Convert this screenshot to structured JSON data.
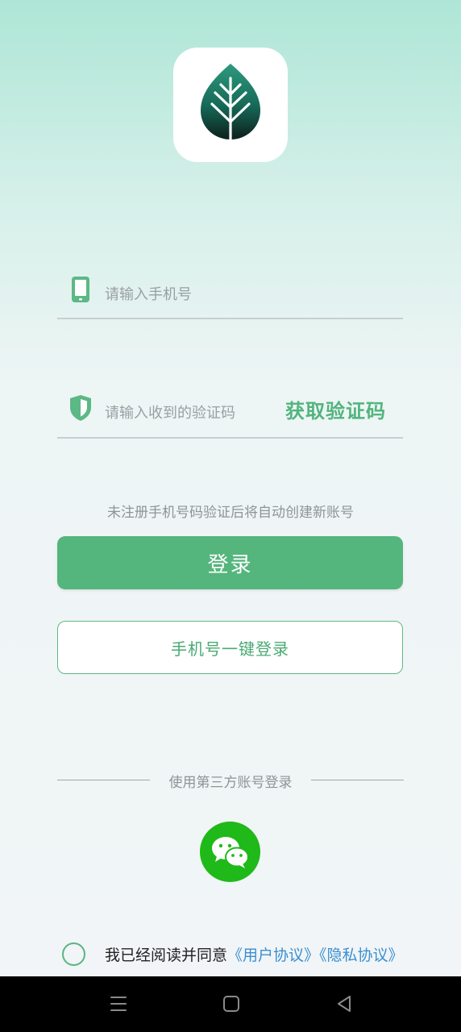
{
  "app": {
    "icon": "leaf-icon",
    "brand_color": "#54b67c"
  },
  "phone_field": {
    "icon": "phone-icon",
    "placeholder": "请输入手机号"
  },
  "code_field": {
    "icon": "shield-icon",
    "placeholder": "请输入收到的验证码",
    "get_code_label": "获取验证码"
  },
  "notice": "未注册手机号码验证后将自动创建新账号",
  "login_button": "登录",
  "one_key_button": "手机号一键登录",
  "third_party": {
    "label": "使用第三方账号登录",
    "wechat_icon": "wechat-icon"
  },
  "agreement": {
    "checked": false,
    "text": "我已经阅读并同意",
    "user_agreement": "《用户协议》",
    "privacy_agreement": "《隐私协议》"
  },
  "navbar": {
    "menu_icon": "menu-icon",
    "home_icon": "home-icon",
    "back_icon": "back-icon"
  }
}
